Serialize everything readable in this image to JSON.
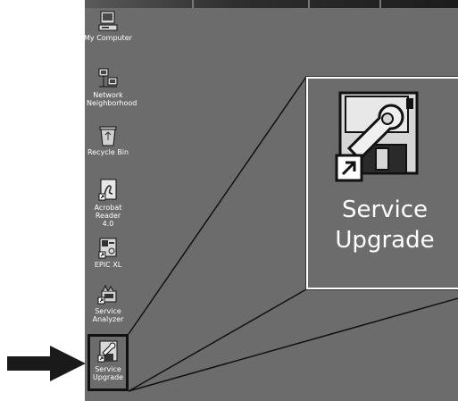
{
  "desktop": {
    "icons": [
      {
        "label": "My Computer",
        "icon": "my-computer-icon"
      },
      {
        "label": "Network Neighborhood",
        "icon": "network-neighborhood-icon"
      },
      {
        "label": "Recycle Bin",
        "icon": "recycle-bin-icon"
      },
      {
        "label": "Acrobat Reader 4.0",
        "icon": "acrobat-reader-icon"
      },
      {
        "label": "EPIC XL",
        "icon": "epic-xl-icon"
      },
      {
        "label": "Service Analyzer",
        "icon": "service-analyzer-icon"
      },
      {
        "label": "Service Upgrade",
        "icon": "service-upgrade-icon",
        "selected": true
      }
    ]
  },
  "zoom": {
    "label_line1": "Service",
    "label_line2": "Upgrade",
    "icon": "service-upgrade-icon"
  },
  "colors": {
    "desktop_bg": "#6c6c6c",
    "icon_text": "#ffffff",
    "pointer_arrow": "#1a1a1a"
  }
}
